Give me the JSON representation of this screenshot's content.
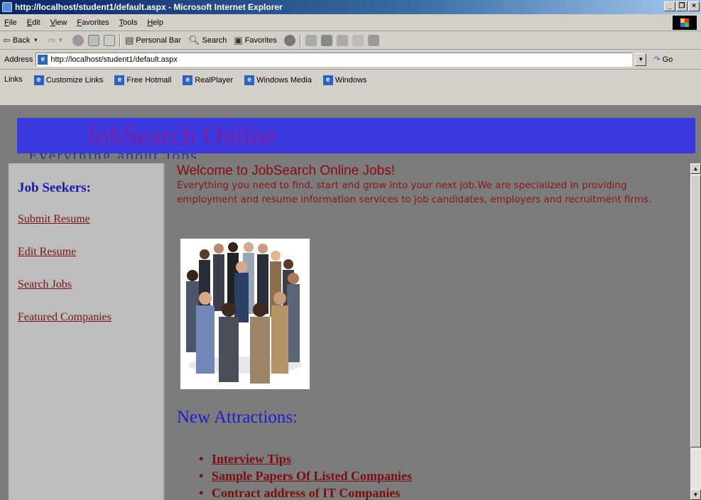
{
  "window": {
    "title": "http://localhost/student1/default.aspx - Microsoft Internet Explorer",
    "controls": [
      "_",
      "❐",
      "×"
    ]
  },
  "menu": [
    "File",
    "Edit",
    "View",
    "Favorites",
    "Tools",
    "Help"
  ],
  "toolbar": {
    "back": "Back",
    "personal_bar": "Personal Bar",
    "search": "Search",
    "favorites": "Favorites"
  },
  "address": {
    "label": "Address",
    "url": "http://localhost/student1/default.aspx",
    "go": "Go"
  },
  "links": {
    "label": "Links",
    "items": [
      "Customize Links",
      "Free Hotmail",
      "RealPlayer",
      "Windows Media",
      "Windows"
    ]
  },
  "banner": {
    "title": "JobSearch Online",
    "subtitle_partial": "Everything about Jobs"
  },
  "sidebar": {
    "heading": "Job Seekers:",
    "links": [
      "Submit Resume",
      "Edit Resume",
      "Search Jobs",
      "Featured Companies"
    ]
  },
  "main": {
    "welcome": "Welcome to JobSearch Online Jobs!",
    "intro": "Everything you need to find, start and grow into your next job.We are specialized in providing employment and resume information services to job candidates, employers and recruitment firms.",
    "new_attractions": "New Attractions:",
    "attractions": [
      "Interview Tips",
      "Sample Papers Of Listed Companies",
      "Contract address of IT Companies"
    ]
  },
  "colors": {
    "banner_bg": "#3a3ae0",
    "banner_title": "#7a1fa0",
    "page_bg": "#7c7c7c",
    "sidebar_bg": "#bdbdbd",
    "link": "#7a1212",
    "heading_blue": "#1a1aa8"
  },
  "icons": {
    "window": "ie-window-icon",
    "home": "home-icon",
    "refresh": "refresh-icon",
    "stop": "stop-icon",
    "history": "history-icon",
    "mail": "mail-icon",
    "print": "print-icon"
  }
}
